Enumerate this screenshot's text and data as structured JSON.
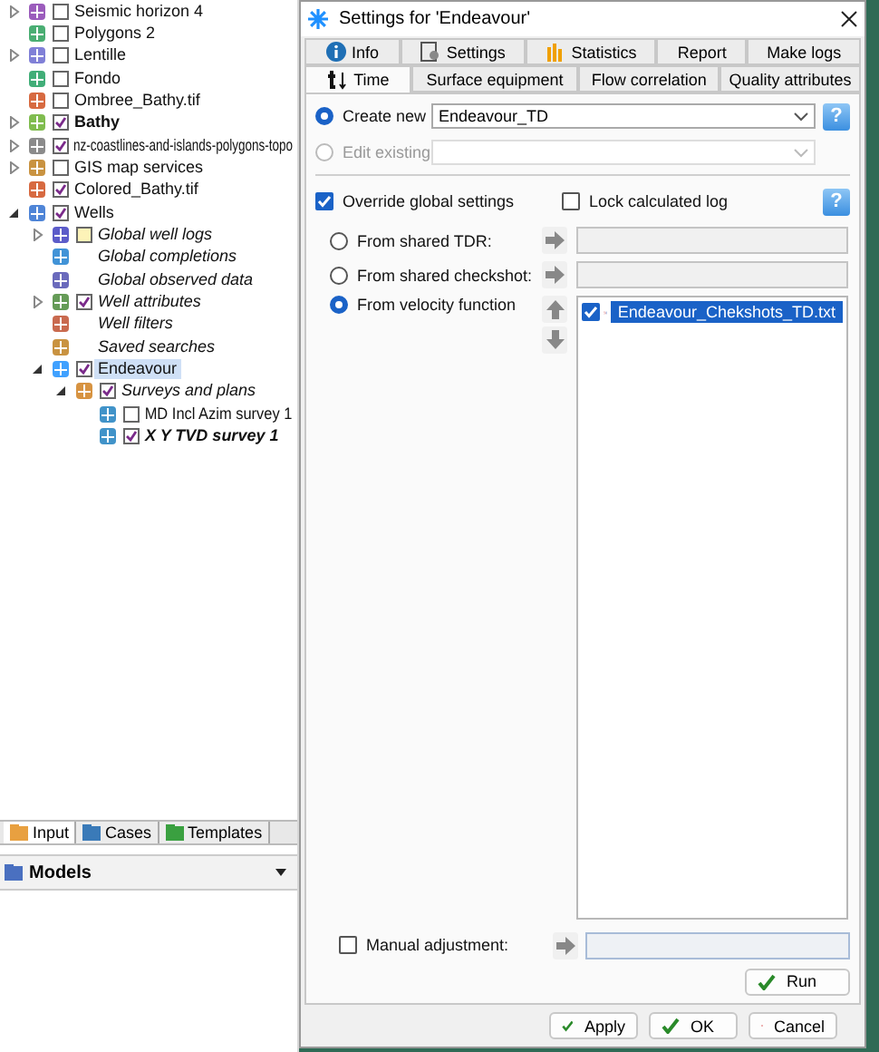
{
  "tree": [
    {
      "label": "Seismic horizon 4",
      "kind": "check",
      "checked": false,
      "selected": false,
      "expanded": false
    },
    {
      "label": "Polygons 2",
      "kind": "check",
      "checked": false,
      "selected": false
    },
    {
      "label": "Lentille",
      "kind": "check",
      "checked": false,
      "selected": false,
      "expanded": false
    },
    {
      "label": "Fondo",
      "kind": "check",
      "checked": false,
      "selected": false
    },
    {
      "label": "Ombree_Bathy.tif",
      "kind": "check",
      "checked": false,
      "selected": false
    },
    {
      "label": "Bathy",
      "kind": "check",
      "checked": true,
      "selected": false,
      "expanded": false
    },
    {
      "label": "nz-coastlines-and-islands-polygons-topo",
      "kind": "check",
      "checked": true,
      "selected": false,
      "expanded": false
    },
    {
      "label": "GIS map services",
      "kind": "check",
      "checked": false,
      "selected": false,
      "expanded": false
    },
    {
      "label": "Colored_Bathy.tif",
      "kind": "check",
      "checked": true,
      "selected": false
    },
    {
      "label": "Wells",
      "kind": "check",
      "checked": true,
      "selected": false,
      "expanded": true,
      "children": [
        {
          "label": "Global well logs",
          "kind": "swatch",
          "checked": false,
          "selected": false,
          "expanded": false
        },
        {
          "label": "Global completions",
          "kind": "plain",
          "selected": false
        },
        {
          "label": "Global observed data",
          "kind": "plain",
          "selected": false
        },
        {
          "label": "Well attributes",
          "kind": "check",
          "checked": true,
          "selected": false,
          "expanded": false
        },
        {
          "label": "Well filters",
          "kind": "plain",
          "selected": false
        },
        {
          "label": "Saved searches",
          "kind": "plain",
          "selected": false
        },
        {
          "label": "Endeavour",
          "kind": "check",
          "checked": true,
          "selected": true,
          "expanded": true,
          "children": [
            {
              "label": "Surveys and plans",
              "kind": "check",
              "checked": true,
              "selected": false,
              "expanded": true,
              "children": [
                {
                  "label": "MD Incl Azim survey 1",
                  "kind": "check",
                  "checked": false,
                  "selected": false
                },
                {
                  "label": "X Y TVD survey 1",
                  "kind": "check",
                  "checked": true,
                  "selected": false
                }
              ]
            }
          ]
        }
      ]
    }
  ],
  "panel_tabs": [
    {
      "label": "Input",
      "selected": true
    },
    {
      "label": "Cases",
      "selected": false
    },
    {
      "label": "Templates",
      "selected": false
    }
  ],
  "models_bar": {
    "label": "Models"
  },
  "dialog": {
    "title": "Settings for 'Endeavour'",
    "tabs_row1": [
      {
        "label": "Info",
        "selected": false
      },
      {
        "label": "Settings",
        "selected": false
      },
      {
        "label": "Statistics",
        "selected": false
      },
      {
        "label": "Report",
        "selected": false
      },
      {
        "label": "Make logs",
        "selected": false
      }
    ],
    "tabs_row2": [
      {
        "label": "Time",
        "selected": true
      },
      {
        "label": "Surface equipment",
        "selected": false
      },
      {
        "label": "Flow correlation",
        "selected": false
      },
      {
        "label": "Quality attributes",
        "selected": false
      }
    ],
    "create_new": {
      "label": "Create new",
      "selected": true,
      "value": "Endeavour_TD",
      "help": "?"
    },
    "edit_existing": {
      "label": "Edit existing",
      "selected": false,
      "disabled": true
    },
    "override": {
      "label": "Override global settings",
      "checked": true,
      "help": "?"
    },
    "lock_log": {
      "label": "Lock calculated log",
      "checked": false
    },
    "sources": [
      {
        "label": "From shared TDR:",
        "selected": false
      },
      {
        "label": "From shared checkshot:",
        "selected": false
      },
      {
        "label": "From velocity function",
        "selected": true
      }
    ],
    "function_list": [
      {
        "label": "Endeavour_Chekshots_TD.txt",
        "checked": true,
        "selected": true
      }
    ],
    "manual": {
      "label": "Manual adjustment:",
      "checked": false
    },
    "run_button": "Run",
    "buttons": [
      {
        "label": "Apply",
        "kind": "confirm"
      },
      {
        "label": "OK",
        "kind": "confirm"
      },
      {
        "label": "Cancel",
        "kind": "cancel"
      }
    ]
  }
}
